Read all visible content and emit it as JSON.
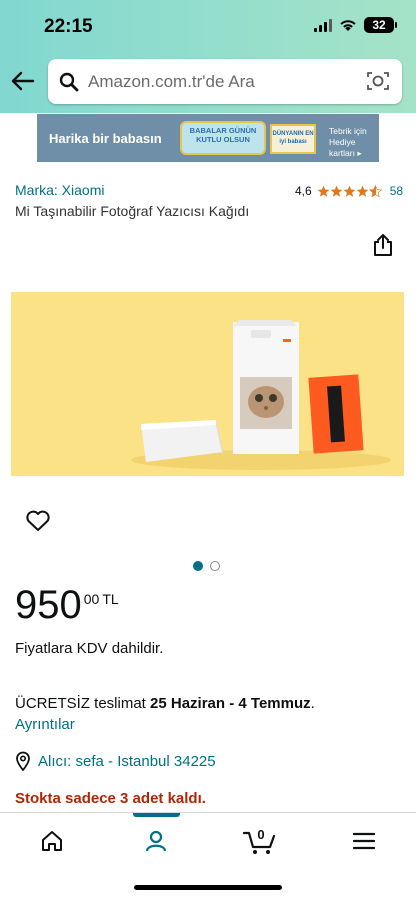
{
  "status_bar": {
    "time": "22:15",
    "battery": "32"
  },
  "search": {
    "placeholder": "Amazon.com.tr'de Ara"
  },
  "banner": {
    "left_text": "Harika bir babasın",
    "badge1_text": "BABALAR GÜNÜN KUTLU OLSUN",
    "badge2_text": "DÜNYANIN EN iyi babası",
    "right_line1": "Tebrik için",
    "right_line2": "Hediye kartları ▸"
  },
  "product": {
    "brand_link": "Marka: Xiaomi",
    "rating_value": "4,6",
    "rating_stars": 4.5,
    "rating_count": "58",
    "title": "Mi Taşınabilir Fotoğraf Yazıcısı Kağıdı"
  },
  "carousel": {
    "total": 2,
    "active_index": 0
  },
  "price": {
    "main": "950",
    "fraction": "00",
    "currency": "TL"
  },
  "vat_note": "Fiyatlara KDV dahildir.",
  "delivery": {
    "prefix": "ÜCRETSİZ teslimat ",
    "dates": "25 Haziran - 4 Temmuz",
    "suffix": ".",
    "details_link": "Ayrıntılar"
  },
  "location": {
    "text": "Alıcı: sefa - Istanbul 34225"
  },
  "stock": {
    "text": "Stokta sadece 3 adet kaldı."
  },
  "bottom_nav": {
    "cart_count": "0",
    "active": "account",
    "items": [
      "home-icon",
      "account-icon",
      "cart-icon",
      "menu-icon"
    ]
  },
  "colors": {
    "header_start": "#81d8d0",
    "header_end": "#a5e3c8",
    "link": "#007185",
    "star": "#de7921",
    "stock_red": "#b12704",
    "product_bg": "#fbe286"
  }
}
